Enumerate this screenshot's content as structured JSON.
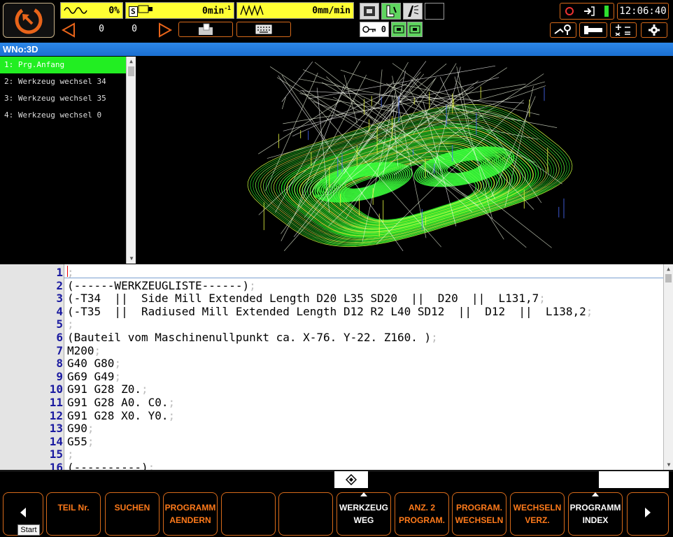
{
  "status": {
    "spindle_percent": "0%",
    "spindle_label": "S",
    "spindle_speed": "0min",
    "spindle_unit_sup": "-1",
    "feed_rate": "0mm/min",
    "left_value": "0",
    "right_value": "0",
    "tool_value": "0",
    "time": "12:06:40"
  },
  "window_title": "WNo:3D",
  "program_list": [
    {
      "label": "1: Prg.Anfang",
      "selected": true
    },
    {
      "label": "2: Werkzeug wechsel 34",
      "selected": false
    },
    {
      "label": "3: Werkzeug wechsel 35",
      "selected": false
    },
    {
      "label": "4: Werkzeug wechsel 0",
      "selected": false
    }
  ],
  "editor_lines": [
    {
      "n": "1",
      "code": "",
      "semi": ";"
    },
    {
      "n": "2",
      "code": "(------WERKZEUGLISTE------)",
      "semi": ";"
    },
    {
      "n": "3",
      "code": "(-T34  ||  Side Mill Extended Length D20 L35 SD20  ||  D20  ||  L131,7",
      "semi": ";"
    },
    {
      "n": "4",
      "code": "(-T35  ||  Radiused Mill Extended Length D12 R2 L40 SD12  ||  D12  ||  L138,2",
      "semi": ";"
    },
    {
      "n": "5",
      "code": "",
      "semi": ";"
    },
    {
      "n": "6",
      "code": "(Bauteil vom Maschinenullpunkt ca. X-76. Y-22. Z160. )",
      "semi": ";"
    },
    {
      "n": "7",
      "code": "M200",
      "semi": ";"
    },
    {
      "n": "8",
      "code": "G40 G80",
      "semi": ";"
    },
    {
      "n": "9",
      "code": "G69 G49",
      "semi": ";"
    },
    {
      "n": "10",
      "code": "G91 G28 Z0.",
      "semi": ";"
    },
    {
      "n": "11",
      "code": "G91 G28 A0. C0.",
      "semi": ";"
    },
    {
      "n": "12",
      "code": "G91 G28 X0. Y0.",
      "semi": ";"
    },
    {
      "n": "13",
      "code": "G90",
      "semi": ";"
    },
    {
      "n": "14",
      "code": "G55",
      "semi": ";"
    },
    {
      "n": "15",
      "code": "",
      "semi": ";"
    },
    {
      "n": "16",
      "code": "(----------)",
      "semi": ";"
    }
  ],
  "softkeys": {
    "teil_nr": "TEIL Nr.",
    "suchen": "SUCHEN",
    "programm_aendern_1": "PROGRAMM",
    "programm_aendern_2": "AENDERN",
    "werkzeug_weg_1": "WERKZEUG",
    "werkzeug_weg_2": "WEG",
    "anz_program_1": "ANZ. 2",
    "anz_program_2": "PROGRAM.",
    "program_wechseln_1": "PROGRAM.",
    "program_wechseln_2": "WECHSELN",
    "wechseln_verz_1": "WECHSELN",
    "wechseln_verz_2": "VERZ.",
    "programm_index_1": "PROGRAMM",
    "programm_index_2": "INDEX"
  },
  "tooltip": "Start",
  "colors": {
    "accent": "#d76a1a",
    "selection": "#22ee22",
    "title_bar": "#1b6fd1",
    "gauge": "#ffff33"
  }
}
